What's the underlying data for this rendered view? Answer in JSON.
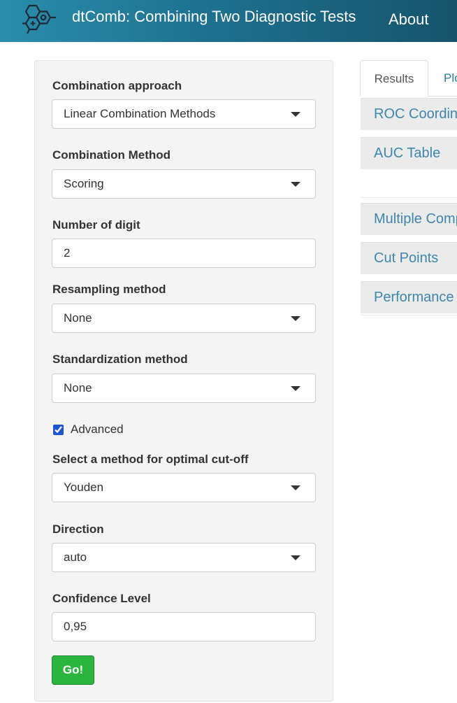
{
  "navbar": {
    "brand": "dtComb: Combining Two Diagnostic Tests",
    "about": "About",
    "logo_icon": "molecule-hexagon-logo"
  },
  "sidebar": {
    "combination_approach": {
      "label": "Combination approach",
      "value": "Linear Combination Methods"
    },
    "combination_method": {
      "label": "Combination Method",
      "value": "Scoring"
    },
    "number_of_digit": {
      "label": "Number of digit",
      "value": "2"
    },
    "resampling_method": {
      "label": "Resampling method",
      "value": "None"
    },
    "standardization_method": {
      "label": "Standardization method",
      "value": "None"
    },
    "advanced": {
      "label": "Advanced",
      "checked": true
    },
    "cutoff_method": {
      "label": "Select a method for optimal cut-off",
      "value": "Youden"
    },
    "direction": {
      "label": "Direction",
      "value": "auto"
    },
    "confidence_level": {
      "label": "Confidence Level",
      "value": "0,95"
    },
    "go_button": "Go!"
  },
  "main": {
    "tabs": [
      {
        "label": "Results",
        "active": true
      },
      {
        "label": "Plo",
        "active": false
      }
    ],
    "panels": [
      {
        "label": "ROC Coordin"
      },
      {
        "label": "AUC Table"
      },
      {
        "label": "Multiple Comp"
      },
      {
        "label": "Cut Points"
      },
      {
        "label": "Performance"
      }
    ]
  },
  "colors": {
    "navbar_start": "#2a8dab",
    "navbar_end": "#17546c",
    "go_button": "#2bb53f",
    "link": "#3e86ab",
    "well_bg": "#f4f4f4"
  }
}
